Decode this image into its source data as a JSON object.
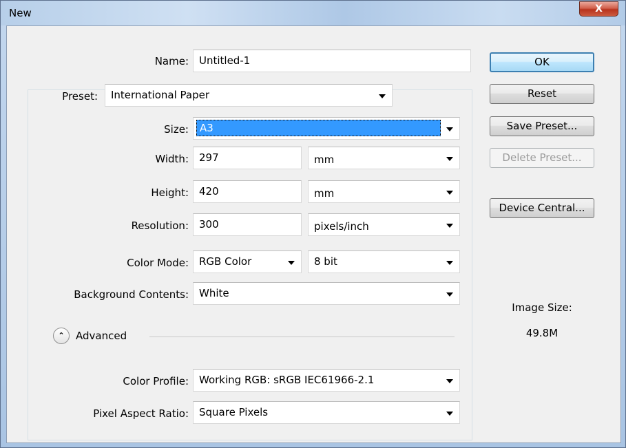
{
  "window": {
    "title": "New",
    "close_label": "X"
  },
  "name": {
    "label": "Name:",
    "value": "Untitled-1"
  },
  "preset": {
    "label": "Preset:",
    "value": "International Paper"
  },
  "size": {
    "label": "Size:",
    "value": "A3"
  },
  "width": {
    "label": "Width:",
    "value": "297",
    "unit": "mm"
  },
  "height": {
    "label": "Height:",
    "value": "420",
    "unit": "mm"
  },
  "resolution": {
    "label": "Resolution:",
    "value": "300",
    "unit": "pixels/inch"
  },
  "color_mode": {
    "label": "Color Mode:",
    "value": "RGB Color",
    "depth": "8 bit"
  },
  "background": {
    "label": "Background Contents:",
    "value": "White"
  },
  "advanced": {
    "label": "Advanced"
  },
  "color_profile": {
    "label": "Color Profile:",
    "value": "Working RGB:  sRGB IEC61966-2.1"
  },
  "pixel_aspect": {
    "label": "Pixel Aspect Ratio:",
    "value": "Square Pixels"
  },
  "buttons": {
    "ok": "OK",
    "reset": "Reset",
    "save_preset": "Save Preset...",
    "delete_preset": "Delete Preset...",
    "device_central": "Device Central..."
  },
  "image_size": {
    "label": "Image Size:",
    "value": "49.8M"
  }
}
